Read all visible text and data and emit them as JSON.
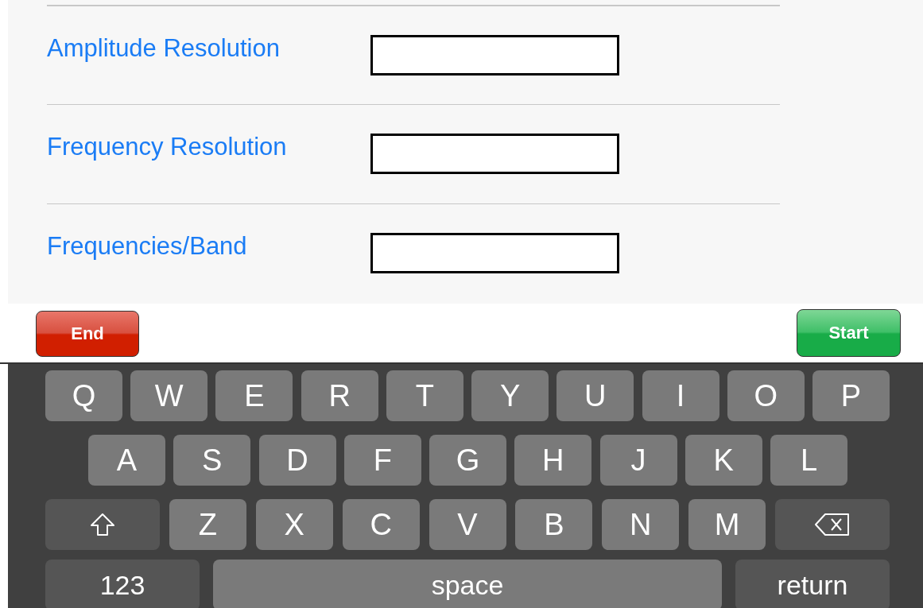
{
  "form": {
    "fields": [
      {
        "label": "Amplitude Resolution"
      },
      {
        "label": "Frequency Resolution"
      },
      {
        "label": "Frequencies/Band"
      }
    ]
  },
  "buttons": [
    {
      "label": "End",
      "kind": "stop"
    },
    {
      "label": "Start",
      "kind": "go"
    }
  ],
  "keyboard": {
    "rows": [
      [
        {
          "kind": "letter",
          "label": "Q"
        },
        {
          "kind": "letter",
          "label": "W"
        },
        {
          "kind": "letter",
          "label": "E"
        },
        {
          "kind": "letter",
          "label": "R"
        },
        {
          "kind": "letter",
          "label": "T"
        },
        {
          "kind": "letter",
          "label": "Y"
        },
        {
          "kind": "letter",
          "label": "U"
        },
        {
          "kind": "letter",
          "label": "I"
        },
        {
          "kind": "letter",
          "label": "O"
        },
        {
          "kind": "letter",
          "label": "P"
        }
      ],
      [
        {
          "kind": "letter",
          "label": "A"
        },
        {
          "kind": "letter",
          "label": "S"
        },
        {
          "kind": "letter",
          "label": "D"
        },
        {
          "kind": "letter",
          "label": "F"
        },
        {
          "kind": "letter",
          "label": "G"
        },
        {
          "kind": "letter",
          "label": "H"
        },
        {
          "kind": "letter",
          "label": "J"
        },
        {
          "kind": "letter",
          "label": "K"
        },
        {
          "kind": "letter",
          "label": "L"
        }
      ],
      [
        {
          "kind": "shift"
        },
        {
          "kind": "letter",
          "label": "Z"
        },
        {
          "kind": "letter",
          "label": "X"
        },
        {
          "kind": "letter",
          "label": "C"
        },
        {
          "kind": "letter",
          "label": "V"
        },
        {
          "kind": "letter",
          "label": "B"
        },
        {
          "kind": "letter",
          "label": "N"
        },
        {
          "kind": "letter",
          "label": "M"
        },
        {
          "kind": "backspace"
        }
      ]
    ],
    "bottom_row": [
      {
        "kind": "numbers",
        "label": "123"
      },
      {
        "kind": "space",
        "label": "space"
      },
      {
        "kind": "return",
        "label": "return"
      }
    ]
  }
}
